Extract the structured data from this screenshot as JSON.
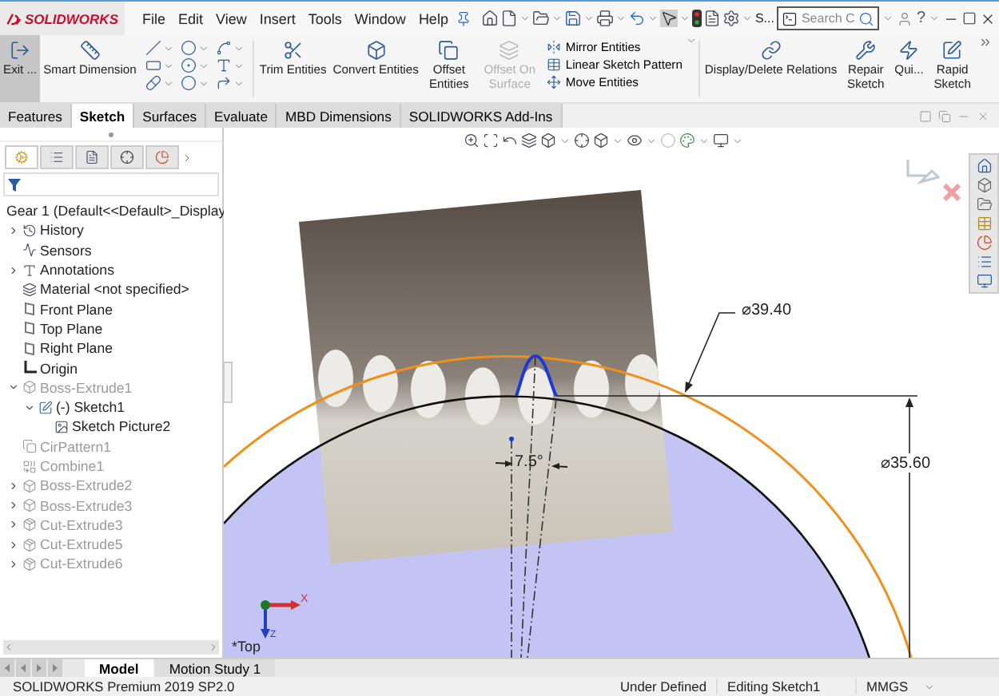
{
  "app": {
    "logo": "SOLIDWORKS",
    "menu": [
      "File",
      "Edit",
      "View",
      "Insert",
      "Tools",
      "Window",
      "Help"
    ],
    "quick_label": "S...",
    "search": {
      "placeholder": "Search C"
    },
    "help": "?"
  },
  "ribbon": {
    "sketch_buttons": [
      {
        "label": "Exit ...",
        "kind": "exit",
        "selected": true,
        "disabled": false
      },
      {
        "label": "Smart Dimension",
        "kind": "dimension",
        "selected": false,
        "disabled": false
      }
    ],
    "entity_buttons": [
      {
        "label": "Trim Entities",
        "kind": "trim",
        "selected": false,
        "disabled": false
      },
      {
        "label": "Convert Entities",
        "kind": "convert",
        "selected": false,
        "disabled": false
      },
      {
        "label": "Offset Entities",
        "kind": "offset",
        "selected": false,
        "disabled": false
      },
      {
        "label": "Offset On Surface",
        "kind": "offsetsurface",
        "selected": false,
        "disabled": true
      }
    ],
    "pattern_menu": [
      {
        "label": "Mirror Entities",
        "kind": "mirror"
      },
      {
        "label": "Linear Sketch Pattern",
        "kind": "linear"
      },
      {
        "label": "Move Entities",
        "kind": "move"
      }
    ],
    "relation_buttons": [
      {
        "label": "Display/Delete Relations",
        "kind": "relations",
        "selected": false,
        "disabled": false
      },
      {
        "label": "Repair Sketch",
        "kind": "repair",
        "selected": false,
        "disabled": false
      },
      {
        "label": "Qui...",
        "kind": "quicksnaps",
        "selected": false,
        "disabled": false
      },
      {
        "label": "Rapid Sketch",
        "kind": "rapid",
        "selected": false,
        "disabled": false
      }
    ]
  },
  "command_tabs": [
    {
      "label": "Features",
      "selected": false
    },
    {
      "label": "Sketch",
      "selected": true
    },
    {
      "label": "Surfaces",
      "selected": false
    },
    {
      "label": "Evaluate",
      "selected": false
    },
    {
      "label": "MBD Dimensions",
      "selected": false
    },
    {
      "label": "SOLIDWORKS Add-Ins",
      "selected": false
    }
  ],
  "panel_tabs": [
    {
      "kind": "tree",
      "selected": true
    },
    {
      "kind": "properties",
      "selected": false
    },
    {
      "kind": "configurations",
      "selected": false
    },
    {
      "kind": "dimxpert",
      "selected": false
    },
    {
      "kind": "display",
      "selected": false
    }
  ],
  "tree": {
    "root": {
      "label": "Gear 1  (Default<<Default>_Display",
      "kind": "part"
    },
    "items": [
      {
        "label": "History",
        "kind": "history",
        "expanded": false,
        "disabled": false
      },
      {
        "label": "Sensors",
        "kind": "sensors",
        "disabled": false
      },
      {
        "label": "Annotations",
        "kind": "annotations",
        "expanded": false,
        "disabled": false
      },
      {
        "label": "Material <not specified>",
        "kind": "material",
        "disabled": false
      },
      {
        "label": "Front Plane",
        "kind": "plane",
        "disabled": false
      },
      {
        "label": "Top Plane",
        "kind": "plane",
        "disabled": false
      },
      {
        "label": "Right Plane",
        "kind": "plane",
        "disabled": false
      },
      {
        "label": "Origin",
        "kind": "origin",
        "disabled": false
      },
      {
        "label": "Boss-Extrude1",
        "kind": "extrude",
        "expanded": true,
        "disabled": true,
        "children": [
          {
            "label": "(-) Sketch1",
            "kind": "sketch",
            "expanded": true,
            "disabled": false,
            "children": [
              {
                "label": "Sketch Picture2",
                "kind": "picture",
                "disabled": false
              }
            ]
          }
        ]
      },
      {
        "label": "CirPattern1",
        "kind": "pattern",
        "disabled": true
      },
      {
        "label": "Combine1",
        "kind": "combine",
        "disabled": true
      },
      {
        "label": "Boss-Extrude2",
        "kind": "extrude",
        "expanded": false,
        "disabled": true
      },
      {
        "label": "Boss-Extrude3",
        "kind": "extrude",
        "expanded": false,
        "disabled": true
      },
      {
        "label": "Cut-Extrude3",
        "kind": "cut",
        "expanded": false,
        "disabled": true
      },
      {
        "label": "Cut-Extrude5",
        "kind": "cut",
        "expanded": false,
        "disabled": true
      },
      {
        "label": "Cut-Extrude6",
        "kind": "cut",
        "expanded": false,
        "disabled": true
      }
    ]
  },
  "sketch": {
    "outer_diameter": "⌀39.40",
    "inner_diameter": "⌀35.60",
    "angle": "7.5°",
    "view": "*Top",
    "axes": [
      "X",
      "Z"
    ]
  },
  "model_tabs": [
    {
      "label": "Model",
      "selected": true
    },
    {
      "label": "Motion Study 1",
      "selected": false
    }
  ],
  "status": {
    "product": "SOLIDWORKS Premium 2019 SP2.0",
    "state": "Under Defined",
    "mode": "Editing Sketch1",
    "units": "MMGS"
  }
}
